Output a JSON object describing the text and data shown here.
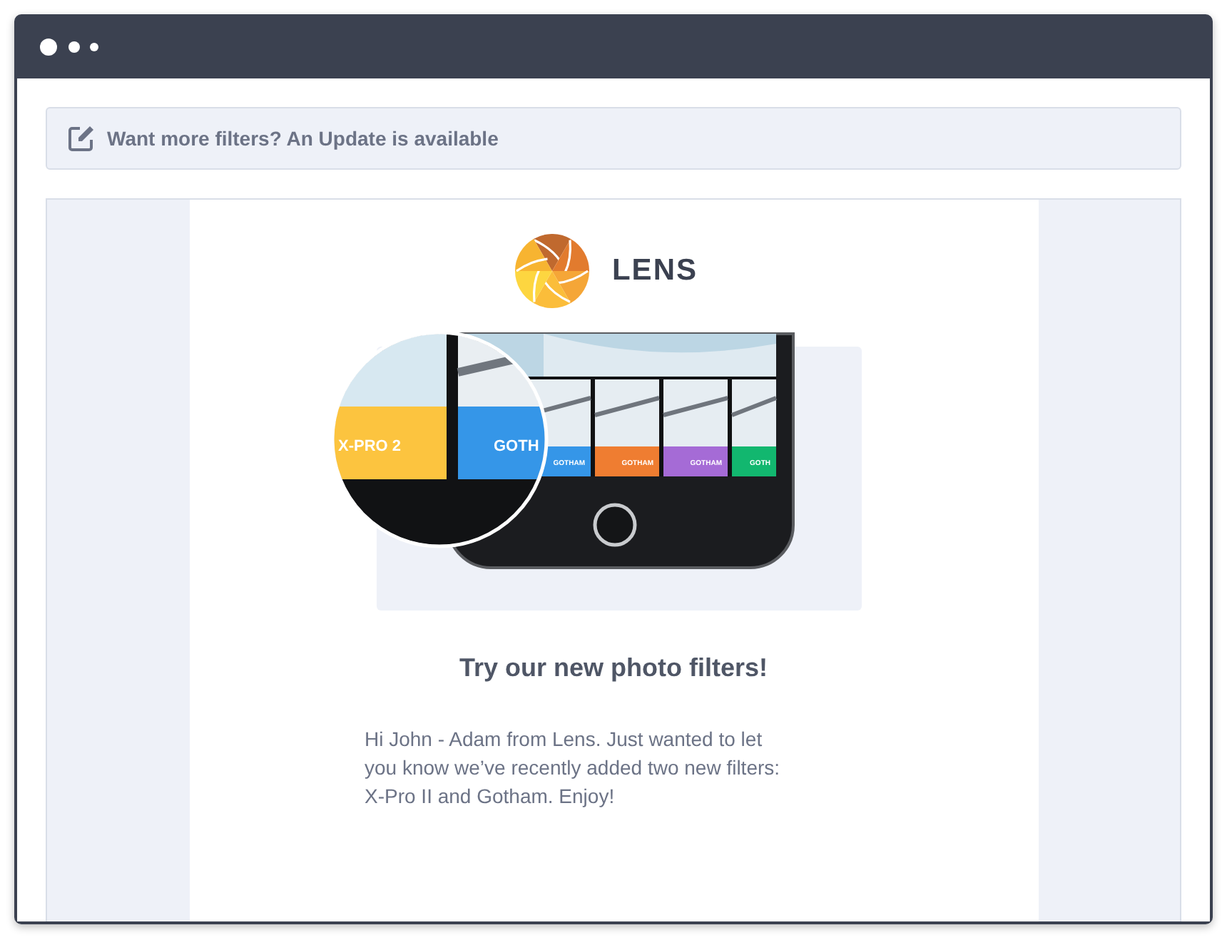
{
  "notice": {
    "text": "Want more filters? An Update is available"
  },
  "email": {
    "brand": "LENS",
    "hero": {
      "tiles": [
        {
          "kind": "zoomed",
          "label": "X-PRO 2",
          "color": "#fcc43f"
        },
        {
          "kind": "zoomed",
          "label": "GOTH",
          "color": "#3596e8"
        },
        {
          "kind": "tile",
          "label": "GOTHAM",
          "color": "#3596e8"
        },
        {
          "kind": "tile",
          "label": "GOTHAM",
          "color": "#ef7d31"
        },
        {
          "kind": "tile",
          "label": "GOTHAM",
          "color": "#a56bd6"
        },
        {
          "kind": "tile",
          "label": "GOTH",
          "color": "#12b76f"
        }
      ]
    },
    "headline": "Try our new photo filters!",
    "body": "Hi John - Adam from Lens. Just wanted to let you know we’ve recently added two new filters: X-Pro II and Gotham. Enjoy!"
  }
}
